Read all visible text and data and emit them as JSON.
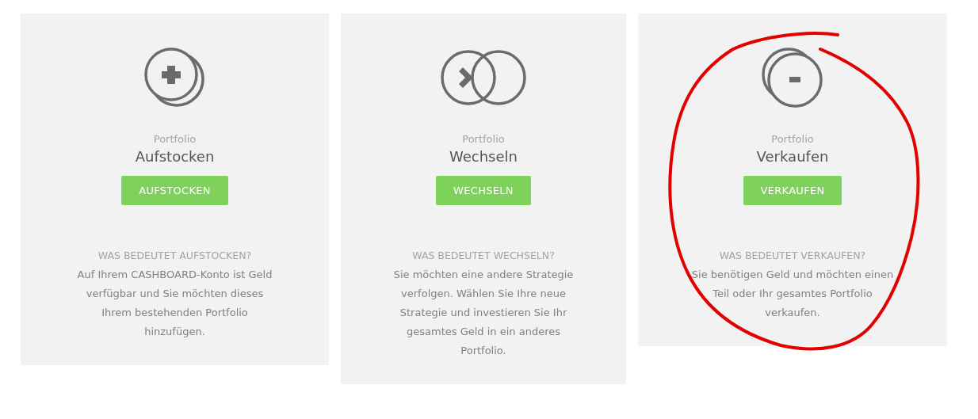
{
  "cards": [
    {
      "kind": "add",
      "eyebrow": "Portfolio",
      "title": "Aufstocken",
      "button": "AUFSTOCKEN",
      "question": "WAS BEDEUTET AUFSTOCKEN?",
      "text": "Auf Ihrem CASHBOARD-Konto ist Geld verfügbar und Sie möchten dieses Ihrem bestehenden Portfolio hinzufügen."
    },
    {
      "kind": "switch",
      "eyebrow": "Portfolio",
      "title": "Wechseln",
      "button": "WECHSELN",
      "question": "WAS BEDEUTET WECHSELN?",
      "text": "Sie möchten eine andere Strategie verfolgen. Wählen Sie Ihre neue Strategie und investieren Sie Ihr gesamtes Geld in ein anderes Portfolio."
    },
    {
      "kind": "remove",
      "eyebrow": "Portfolio",
      "title": "Verkaufen",
      "button": "VERKAUFEN",
      "question": "WAS BEDEUTET VERKAUFEN?",
      "text": "Sie benötigen Geld und möchten einen Teil oder Ihr gesamtes Portfolio verkaufen."
    }
  ],
  "annotation": {
    "kind": "circle",
    "color": "#e50000"
  }
}
